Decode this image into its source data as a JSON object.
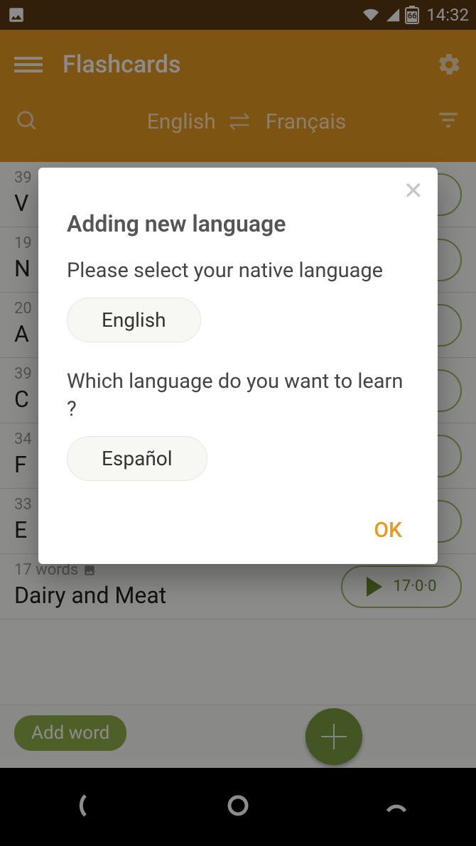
{
  "statusbar": {
    "time": "14:32",
    "battery": "66"
  },
  "header": {
    "title": "Flashcards",
    "source_lang": "English",
    "target_lang": "Français"
  },
  "list": {
    "items": [
      {
        "count": "39",
        "name": "V"
      },
      {
        "count": "19",
        "name": "N"
      },
      {
        "count": "20",
        "name": "A"
      },
      {
        "count": "39",
        "name": "C"
      },
      {
        "count": "34",
        "name": "F"
      },
      {
        "count": "33",
        "name": "E"
      },
      {
        "count": "17 words",
        "name": "Dairy and Meat",
        "pill": "17·0·0"
      }
    ]
  },
  "addbar": {
    "label": "Add word"
  },
  "dialog": {
    "title": "Adding new language",
    "q1": "Please select your native language",
    "a1": "English",
    "q2": "Which language do you want to learn ?",
    "a2": "Español",
    "ok": "OK"
  }
}
